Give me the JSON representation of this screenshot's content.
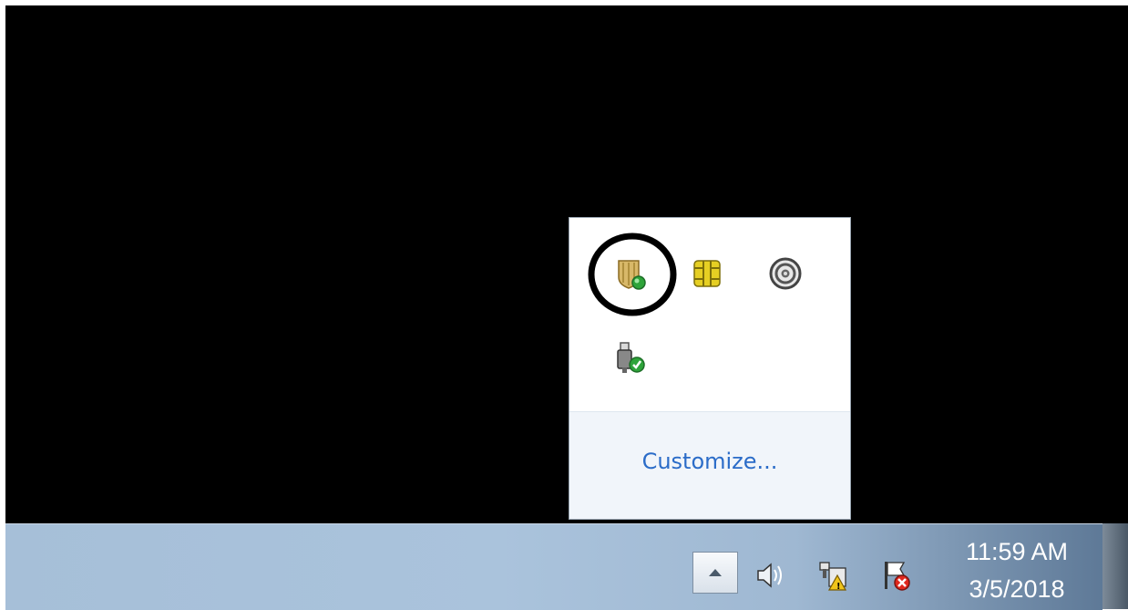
{
  "desktop": {
    "background": "#000000"
  },
  "tray_popup": {
    "icons": [
      "shield-icon",
      "smart-card-icon",
      "spiral-icon",
      "usb-safe-remove-icon"
    ],
    "customize_label": "Customize...",
    "link_color": "#2b6cc8"
  },
  "taskbar": {
    "icons": [
      "show-hidden-icons-arrow",
      "speaker-icon",
      "network-warning-icon",
      "action-center-flag-icon"
    ],
    "clock": {
      "time": "11:59 AM",
      "date": "3/5/2018"
    }
  }
}
